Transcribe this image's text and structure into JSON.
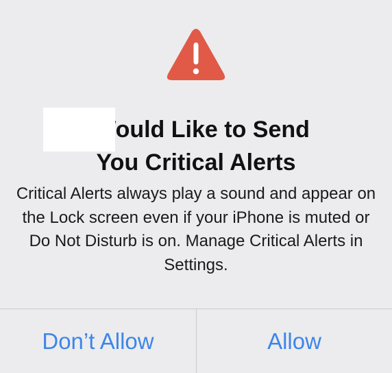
{
  "alert": {
    "icon": "warning-triangle-icon",
    "icon_color": "#e05a47",
    "title_line1": "’ Would Like to Send",
    "title_line2": "You Critical Alerts",
    "message": "Critical Alerts always play a sound and appear on the Lock screen even if your iPhone is muted or Do Not Disturb is on. Manage Critical Alerts in Settings.",
    "buttons": {
      "dont_allow": "Don’t Allow",
      "allow": "Allow"
    },
    "button_color": "#3d86e8"
  }
}
